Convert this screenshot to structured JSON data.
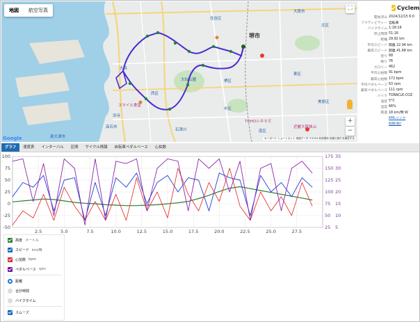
{
  "map": {
    "type_buttons": [
      "地図",
      "航空写真"
    ],
    "active_type": "地図",
    "google_logo": "Google",
    "attribution": "キーボード ショートカット   地図データ ©2024   利用規約   地図の誤りを報告する",
    "labels": [
      "堺市",
      "大阪市",
      "泉大津市",
      "高石市",
      "石津川",
      "大仙公園",
      "住吉区",
      "東区",
      "南区",
      "中区",
      "大浜",
      "浜寺",
      "西区",
      "北区",
      "美原区",
      "堺区",
      "TOHOシネマズ",
      "スマイル食堂",
      "近畿大阪狭山"
    ],
    "zoom_in": "+",
    "zoom_out": "−",
    "fullscreen_icon": "fullscreen-icon"
  },
  "stats": {
    "app_name": "Cyclemo",
    "rows": [
      {
        "k": "開始済み",
        "v": "2024/12/15 6:0"
      },
      {
        "k": "アクティビティー",
        "v": "自転車"
      },
      {
        "k": "バイクタイム",
        "v": "1:18:16"
      },
      {
        "k": "停止時間",
        "v": "51:16"
      },
      {
        "k": "距離",
        "v": "29.92 km"
      },
      {
        "k": "平均スピード",
        "v": "関連 22.94 km"
      },
      {
        "k": "最高スピード",
        "v": "関連 41.68 km"
      },
      {
        "k": "登り",
        "v": "68"
      },
      {
        "k": "降り",
        "v": "76"
      },
      {
        "k": "カロリー",
        "v": "462"
      },
      {
        "k": "平均心拍数",
        "v": "91 bpm"
      },
      {
        "k": "最高心拍数",
        "v": "172 bpm"
      },
      {
        "k": "平均ペダルベース",
        "v": "63 rpm"
      },
      {
        "k": "最高ペダルベース",
        "v": "111 rpm"
      },
      {
        "k": "バイク",
        "v": "TORACLE-COZ"
      },
      {
        "k": "温度",
        "v": "5°C"
      },
      {
        "k": "湿度",
        "v": "66%"
      },
      {
        "k": "風速",
        "v": "18 km/時 W"
      },
      {
        "k": "",
        "v": "KMLリンク",
        "link": true
      },
      {
        "k": "",
        "v": "削除(削)",
        "link": true
      }
    ]
  },
  "tabs": [
    "グラフ",
    "速度表",
    "インターバル",
    "区間",
    "サイクル情報",
    "自転車ペダルベース",
    "心拍数"
  ],
  "active_tab": "グラフ",
  "options": {
    "series": [
      {
        "label": "高度",
        "unit": "メートル",
        "color": "#2e7d32",
        "checked": true
      },
      {
        "label": "スピード",
        "unit": "km/時",
        "color": "#1565c0",
        "checked": true
      },
      {
        "label": "心拍数",
        "unit": "bpm",
        "color": "#d32f2f",
        "checked": true
      },
      {
        "label": "ペダルベース",
        "unit": "rpm",
        "color": "#6a1b9a",
        "checked": true
      }
    ],
    "x_modes": [
      {
        "label": "距離",
        "selected": true
      },
      {
        "label": "合計時間",
        "selected": false
      },
      {
        "label": "バイクタイム",
        "selected": false
      }
    ],
    "smooth": {
      "label": "スムーズ",
      "checked": true,
      "color": "#1565c0"
    }
  },
  "chart_data": {
    "type": "line",
    "title": "",
    "xlabel": "",
    "ylabel": "",
    "grid": true,
    "xlim": [
      0,
      30
    ],
    "x_ticks": [
      2.5,
      5.0,
      7.5,
      10.0,
      12.5,
      15.0,
      17.5,
      20.0,
      22.5,
      25.0,
      27.5
    ],
    "left_axis": {
      "ylim": [
        -50,
        100
      ],
      "ticks": [
        -50,
        -25,
        0,
        25,
        50,
        75,
        100
      ]
    },
    "right_axis_1": {
      "ylim": [
        25,
        175
      ],
      "ticks": [
        25,
        50,
        75,
        100,
        125,
        150,
        175
      ]
    },
    "right_axis_2": {
      "ylim": [
        5,
        35
      ],
      "ticks": [
        5,
        10,
        15,
        20,
        25,
        30,
        35
      ]
    },
    "series": [
      {
        "name": "高度",
        "axis": "left",
        "color": "#2e7d32",
        "x": [
          0,
          1,
          2,
          3,
          4,
          5,
          6,
          7,
          8,
          9,
          10,
          11,
          12,
          13,
          14,
          15,
          16,
          17,
          18,
          19,
          20,
          21,
          22,
          23,
          24,
          25,
          26,
          27,
          28,
          29
        ],
        "y": [
          4,
          6,
          8,
          10,
          9,
          6,
          3,
          1,
          0,
          -2,
          -3,
          -4,
          -4,
          -3,
          -2,
          0,
          2,
          5,
          11,
          18,
          26,
          33,
          36,
          32,
          28,
          24,
          20,
          16,
          12,
          8
        ]
      },
      {
        "name": "スピード",
        "axis": "right_axis_2",
        "color": "#1e3fd6",
        "x": [
          0,
          1,
          2,
          3,
          4,
          5,
          6,
          7,
          8,
          9,
          10,
          11,
          12,
          13,
          14,
          15,
          16,
          17,
          18,
          19,
          20,
          21,
          22,
          23,
          24,
          25,
          26,
          27,
          28,
          29
        ],
        "y": [
          18,
          24,
          22,
          27,
          12,
          25,
          26,
          8,
          24,
          10,
          26,
          22,
          28,
          15,
          24,
          27,
          20,
          26,
          25,
          12,
          28,
          26,
          25,
          10,
          27,
          20,
          24,
          18,
          26,
          22
        ]
      },
      {
        "name": "心拍数",
        "axis": "right_axis_1",
        "color": "#e53935",
        "x": [
          0,
          1,
          2,
          3,
          4,
          5,
          6,
          7,
          8,
          9,
          10,
          11,
          12,
          13,
          14,
          15,
          16,
          17,
          18,
          19,
          20,
          21,
          22,
          23,
          24,
          25,
          26,
          27,
          28,
          29
        ],
        "y": [
          30,
          60,
          45,
          95,
          40,
          110,
          70,
          40,
          80,
          40,
          95,
          40,
          130,
          60,
          100,
          45,
          150,
          95,
          60,
          120,
          80,
          150,
          70,
          40,
          100,
          60,
          90,
          50,
          120,
          70
        ]
      },
      {
        "name": "ペダルベース",
        "axis": "right_axis_2",
        "color": "#8e24aa",
        "x": [
          0,
          1,
          2,
          3,
          4,
          5,
          6,
          7,
          8,
          9,
          10,
          11,
          12,
          13,
          14,
          15,
          16,
          17,
          18,
          19,
          20,
          21,
          22,
          23,
          24,
          25,
          26,
          27,
          28,
          29
        ],
        "y": [
          33,
          34,
          16,
          32,
          10,
          34,
          30,
          6,
          34,
          8,
          33,
          32,
          34,
          12,
          30,
          34,
          33,
          12,
          34,
          30,
          34,
          20,
          33,
          8,
          30,
          32,
          12,
          30,
          33,
          28
        ]
      }
    ]
  }
}
